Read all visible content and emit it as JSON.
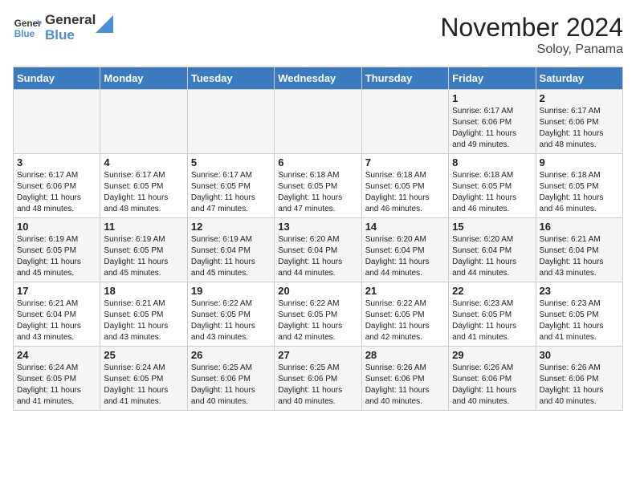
{
  "logo": {
    "line1": "General",
    "line2": "Blue"
  },
  "title": "November 2024",
  "subtitle": "Soloy, Panama",
  "days_header": [
    "Sunday",
    "Monday",
    "Tuesday",
    "Wednesday",
    "Thursday",
    "Friday",
    "Saturday"
  ],
  "weeks": [
    [
      {
        "day": "",
        "info": ""
      },
      {
        "day": "",
        "info": ""
      },
      {
        "day": "",
        "info": ""
      },
      {
        "day": "",
        "info": ""
      },
      {
        "day": "",
        "info": ""
      },
      {
        "day": "1",
        "info": "Sunrise: 6:17 AM\nSunset: 6:06 PM\nDaylight: 11 hours\nand 49 minutes."
      },
      {
        "day": "2",
        "info": "Sunrise: 6:17 AM\nSunset: 6:06 PM\nDaylight: 11 hours\nand 48 minutes."
      }
    ],
    [
      {
        "day": "3",
        "info": "Sunrise: 6:17 AM\nSunset: 6:06 PM\nDaylight: 11 hours\nand 48 minutes."
      },
      {
        "day": "4",
        "info": "Sunrise: 6:17 AM\nSunset: 6:05 PM\nDaylight: 11 hours\nand 48 minutes."
      },
      {
        "day": "5",
        "info": "Sunrise: 6:17 AM\nSunset: 6:05 PM\nDaylight: 11 hours\nand 47 minutes."
      },
      {
        "day": "6",
        "info": "Sunrise: 6:18 AM\nSunset: 6:05 PM\nDaylight: 11 hours\nand 47 minutes."
      },
      {
        "day": "7",
        "info": "Sunrise: 6:18 AM\nSunset: 6:05 PM\nDaylight: 11 hours\nand 46 minutes."
      },
      {
        "day": "8",
        "info": "Sunrise: 6:18 AM\nSunset: 6:05 PM\nDaylight: 11 hours\nand 46 minutes."
      },
      {
        "day": "9",
        "info": "Sunrise: 6:18 AM\nSunset: 6:05 PM\nDaylight: 11 hours\nand 46 minutes."
      }
    ],
    [
      {
        "day": "10",
        "info": "Sunrise: 6:19 AM\nSunset: 6:05 PM\nDaylight: 11 hours\nand 45 minutes."
      },
      {
        "day": "11",
        "info": "Sunrise: 6:19 AM\nSunset: 6:05 PM\nDaylight: 11 hours\nand 45 minutes."
      },
      {
        "day": "12",
        "info": "Sunrise: 6:19 AM\nSunset: 6:04 PM\nDaylight: 11 hours\nand 45 minutes."
      },
      {
        "day": "13",
        "info": "Sunrise: 6:20 AM\nSunset: 6:04 PM\nDaylight: 11 hours\nand 44 minutes."
      },
      {
        "day": "14",
        "info": "Sunrise: 6:20 AM\nSunset: 6:04 PM\nDaylight: 11 hours\nand 44 minutes."
      },
      {
        "day": "15",
        "info": "Sunrise: 6:20 AM\nSunset: 6:04 PM\nDaylight: 11 hours\nand 44 minutes."
      },
      {
        "day": "16",
        "info": "Sunrise: 6:21 AM\nSunset: 6:04 PM\nDaylight: 11 hours\nand 43 minutes."
      }
    ],
    [
      {
        "day": "17",
        "info": "Sunrise: 6:21 AM\nSunset: 6:04 PM\nDaylight: 11 hours\nand 43 minutes."
      },
      {
        "day": "18",
        "info": "Sunrise: 6:21 AM\nSunset: 6:05 PM\nDaylight: 11 hours\nand 43 minutes."
      },
      {
        "day": "19",
        "info": "Sunrise: 6:22 AM\nSunset: 6:05 PM\nDaylight: 11 hours\nand 43 minutes."
      },
      {
        "day": "20",
        "info": "Sunrise: 6:22 AM\nSunset: 6:05 PM\nDaylight: 11 hours\nand 42 minutes."
      },
      {
        "day": "21",
        "info": "Sunrise: 6:22 AM\nSunset: 6:05 PM\nDaylight: 11 hours\nand 42 minutes."
      },
      {
        "day": "22",
        "info": "Sunrise: 6:23 AM\nSunset: 6:05 PM\nDaylight: 11 hours\nand 41 minutes."
      },
      {
        "day": "23",
        "info": "Sunrise: 6:23 AM\nSunset: 6:05 PM\nDaylight: 11 hours\nand 41 minutes."
      }
    ],
    [
      {
        "day": "24",
        "info": "Sunrise: 6:24 AM\nSunset: 6:05 PM\nDaylight: 11 hours\nand 41 minutes."
      },
      {
        "day": "25",
        "info": "Sunrise: 6:24 AM\nSunset: 6:05 PM\nDaylight: 11 hours\nand 41 minutes."
      },
      {
        "day": "26",
        "info": "Sunrise: 6:25 AM\nSunset: 6:06 PM\nDaylight: 11 hours\nand 40 minutes."
      },
      {
        "day": "27",
        "info": "Sunrise: 6:25 AM\nSunset: 6:06 PM\nDaylight: 11 hours\nand 40 minutes."
      },
      {
        "day": "28",
        "info": "Sunrise: 6:26 AM\nSunset: 6:06 PM\nDaylight: 11 hours\nand 40 minutes."
      },
      {
        "day": "29",
        "info": "Sunrise: 6:26 AM\nSunset: 6:06 PM\nDaylight: 11 hours\nand 40 minutes."
      },
      {
        "day": "30",
        "info": "Sunrise: 6:26 AM\nSunset: 6:06 PM\nDaylight: 11 hours\nand 40 minutes."
      }
    ]
  ]
}
